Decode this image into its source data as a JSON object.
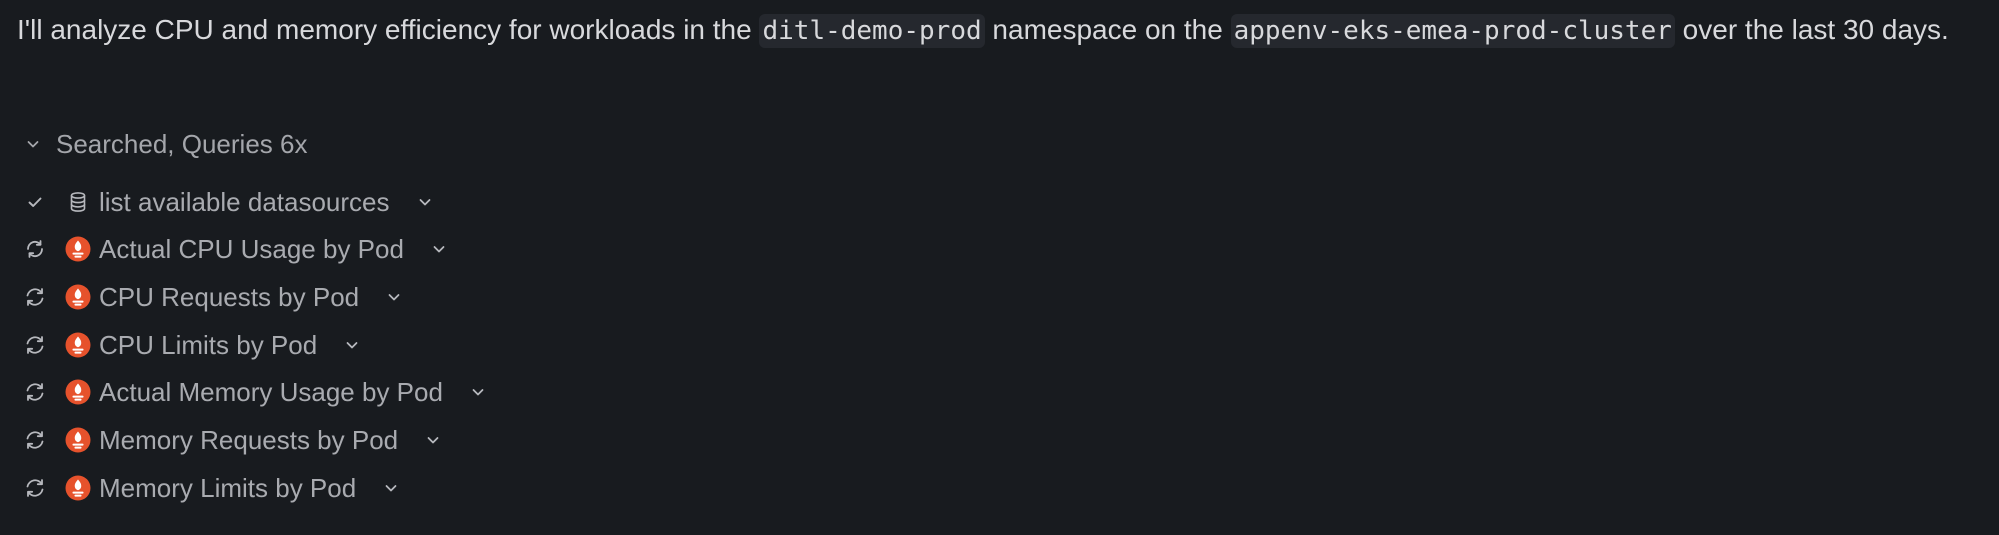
{
  "message": {
    "part1": "I'll analyze CPU and memory efficiency for workloads in the ",
    "namespace": "ditl-demo-prod",
    "part2": " namespace on the ",
    "cluster": "appenv-eks-emea-prod-cluster",
    "part3": " over the last 30 days."
  },
  "summary": {
    "label": "Searched, Queries 6x",
    "icon": "chevron-down-icon"
  },
  "queries": [
    {
      "label": "list available datasources",
      "status": "done",
      "source": "database-icon"
    },
    {
      "label": "Actual CPU Usage by Pod",
      "status": "running",
      "source": "prometheus-icon"
    },
    {
      "label": "CPU Requests by Pod",
      "status": "pending",
      "source": "prometheus-icon"
    },
    {
      "label": "CPU Limits by Pod",
      "status": "pending",
      "source": "prometheus-icon"
    },
    {
      "label": "Actual Memory Usage by Pod",
      "status": "pending",
      "source": "prometheus-icon"
    },
    {
      "label": "Memory Requests by Pod",
      "status": "pending",
      "source": "prometheus-icon"
    },
    {
      "label": "Memory Limits by Pod",
      "status": "pending",
      "source": "prometheus-icon"
    }
  ],
  "colors": {
    "background": "#181b1f",
    "text": "#d8d9dc",
    "muted": "#a9abb0",
    "prometheus": "#e6522c"
  }
}
